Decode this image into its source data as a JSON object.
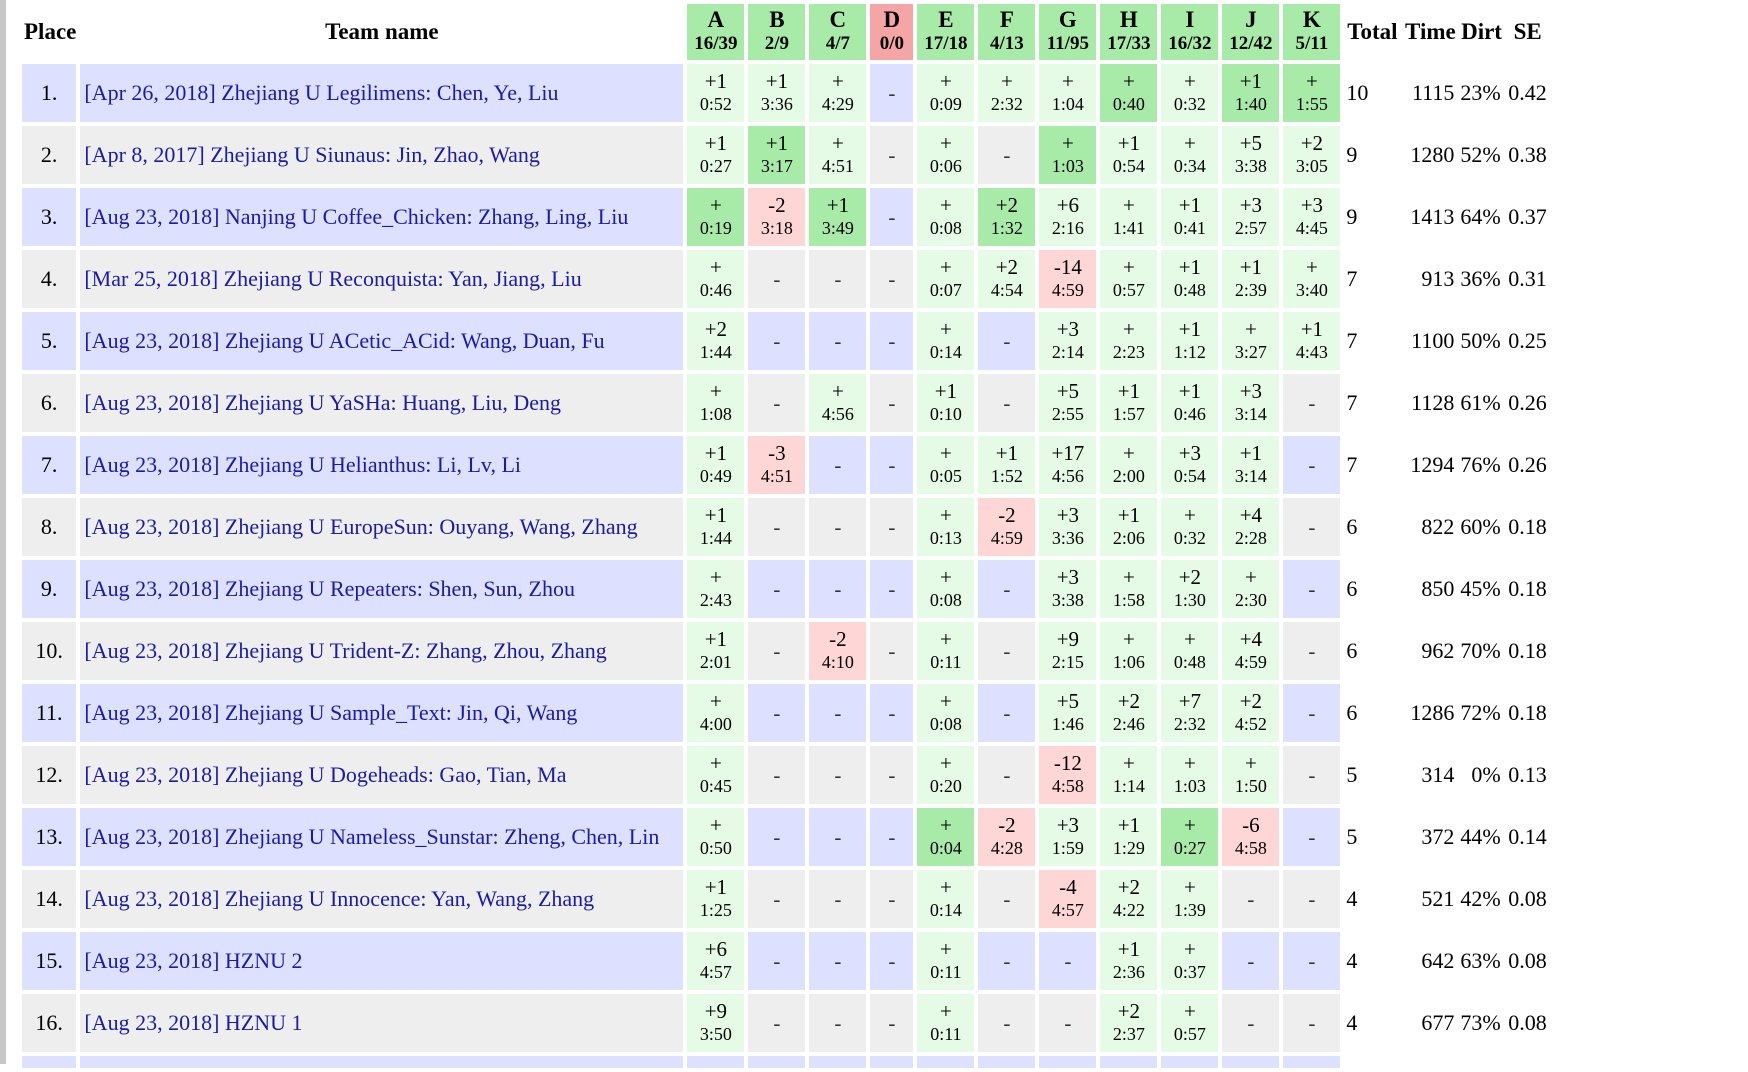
{
  "header": {
    "place": "Place",
    "team": "Team name",
    "total": "Total",
    "time": "Time",
    "dirt": "Dirt",
    "se": "SE"
  },
  "problems": [
    {
      "letter": "A",
      "ratio": "16/39",
      "color": "green"
    },
    {
      "letter": "B",
      "ratio": "2/9",
      "color": "green"
    },
    {
      "letter": "C",
      "ratio": "4/7",
      "color": "green"
    },
    {
      "letter": "D",
      "ratio": "0/0",
      "color": "red"
    },
    {
      "letter": "E",
      "ratio": "17/18",
      "color": "green"
    },
    {
      "letter": "F",
      "ratio": "4/13",
      "color": "green"
    },
    {
      "letter": "G",
      "ratio": "11/95",
      "color": "green"
    },
    {
      "letter": "H",
      "ratio": "17/33",
      "color": "green"
    },
    {
      "letter": "I",
      "ratio": "16/32",
      "color": "green"
    },
    {
      "letter": "J",
      "ratio": "12/42",
      "color": "green"
    },
    {
      "letter": "K",
      "ratio": "5/11",
      "color": "green"
    }
  ],
  "colors": {
    "first_solve": "#a8eba8",
    "solved": "#e5fbe5",
    "failed": "#ffd6d6",
    "row_odd": "#dde0ff",
    "row_even": "#eeeeee",
    "link": "#1a1ab0"
  },
  "rows": [
    {
      "place": "1.",
      "team": "[Apr 26, 2018] Zhejiang U Legilimens: Chen, Ye, Liu",
      "cells": [
        [
          "+1",
          "0:52",
          "s"
        ],
        [
          "+1",
          "3:36",
          "s"
        ],
        [
          "+",
          "4:29",
          "s"
        ],
        [
          "-",
          "",
          "n"
        ],
        [
          "+",
          "0:09",
          "s"
        ],
        [
          "+",
          "2:32",
          "s"
        ],
        [
          "+",
          "1:04",
          "s"
        ],
        [
          "+",
          "0:40",
          "f"
        ],
        [
          "+",
          "0:32",
          "s"
        ],
        [
          "+1",
          "1:40",
          "f"
        ],
        [
          "+",
          "1:55",
          "f"
        ]
      ],
      "total": "10",
      "time": "1115",
      "dirt": "23%",
      "se": "0.42"
    },
    {
      "place": "2.",
      "team": "[Apr 8, 2017] Zhejiang U Siunaus: Jin, Zhao, Wang",
      "cells": [
        [
          "+1",
          "0:27",
          "s"
        ],
        [
          "+1",
          "3:17",
          "f"
        ],
        [
          "+",
          "4:51",
          "s"
        ],
        [
          "-",
          "",
          "n"
        ],
        [
          "+",
          "0:06",
          "s"
        ],
        [
          "-",
          "",
          "n"
        ],
        [
          "+",
          "1:03",
          "f"
        ],
        [
          "+1",
          "0:54",
          "s"
        ],
        [
          "+",
          "0:34",
          "s"
        ],
        [
          "+5",
          "3:38",
          "s"
        ],
        [
          "+2",
          "3:05",
          "s"
        ]
      ],
      "total": "9",
      "time": "1280",
      "dirt": "52%",
      "se": "0.38"
    },
    {
      "place": "3.",
      "team": "[Aug 23, 2018] Nanjing U Coffee_Chicken: Zhang, Ling, Liu",
      "cells": [
        [
          "+",
          "0:19",
          "f"
        ],
        [
          "-2",
          "3:18",
          "x"
        ],
        [
          "+1",
          "3:49",
          "f"
        ],
        [
          "-",
          "",
          "n"
        ],
        [
          "+",
          "0:08",
          "s"
        ],
        [
          "+2",
          "1:32",
          "f"
        ],
        [
          "+6",
          "2:16",
          "s"
        ],
        [
          "+",
          "1:41",
          "s"
        ],
        [
          "+1",
          "0:41",
          "s"
        ],
        [
          "+3",
          "2:57",
          "s"
        ],
        [
          "+3",
          "4:45",
          "s"
        ]
      ],
      "total": "9",
      "time": "1413",
      "dirt": "64%",
      "se": "0.37"
    },
    {
      "place": "4.",
      "team": "[Mar 25, 2018] Zhejiang U Reconquista: Yan, Jiang, Liu",
      "cells": [
        [
          "+",
          "0:46",
          "s"
        ],
        [
          "-",
          "",
          "n"
        ],
        [
          "-",
          "",
          "n"
        ],
        [
          "-",
          "",
          "n"
        ],
        [
          "+",
          "0:07",
          "s"
        ],
        [
          "+2",
          "4:54",
          "s"
        ],
        [
          "-14",
          "4:59",
          "x"
        ],
        [
          "+",
          "0:57",
          "s"
        ],
        [
          "+1",
          "0:48",
          "s"
        ],
        [
          "+1",
          "2:39",
          "s"
        ],
        [
          "+",
          "3:40",
          "s"
        ]
      ],
      "total": "7",
      "time": "913",
      "dirt": "36%",
      "se": "0.31"
    },
    {
      "place": "5.",
      "team": "[Aug 23, 2018] Zhejiang U ACetic_ACid: Wang, Duan, Fu",
      "cells": [
        [
          "+2",
          "1:44",
          "s"
        ],
        [
          "-",
          "",
          "n"
        ],
        [
          "-",
          "",
          "n"
        ],
        [
          "-",
          "",
          "n"
        ],
        [
          "+",
          "0:14",
          "s"
        ],
        [
          "-",
          "",
          "n"
        ],
        [
          "+3",
          "2:14",
          "s"
        ],
        [
          "+",
          "2:23",
          "s"
        ],
        [
          "+1",
          "1:12",
          "s"
        ],
        [
          "+",
          "3:27",
          "s"
        ],
        [
          "+1",
          "4:43",
          "s"
        ]
      ],
      "total": "7",
      "time": "1100",
      "dirt": "50%",
      "se": "0.25"
    },
    {
      "place": "6.",
      "team": "[Aug 23, 2018] Zhejiang U YaSHa: Huang, Liu, Deng",
      "cells": [
        [
          "+",
          "1:08",
          "s"
        ],
        [
          "-",
          "",
          "n"
        ],
        [
          "+",
          "4:56",
          "s"
        ],
        [
          "-",
          "",
          "n"
        ],
        [
          "+1",
          "0:10",
          "s"
        ],
        [
          "-",
          "",
          "n"
        ],
        [
          "+5",
          "2:55",
          "s"
        ],
        [
          "+1",
          "1:57",
          "s"
        ],
        [
          "+1",
          "0:46",
          "s"
        ],
        [
          "+3",
          "3:14",
          "s"
        ],
        [
          "-",
          "",
          "n"
        ]
      ],
      "total": "7",
      "time": "1128",
      "dirt": "61%",
      "se": "0.26"
    },
    {
      "place": "7.",
      "team": "[Aug 23, 2018] Zhejiang U Helianthus: Li, Lv, Li",
      "cells": [
        [
          "+1",
          "0:49",
          "s"
        ],
        [
          "-3",
          "4:51",
          "x"
        ],
        [
          "-",
          "",
          "n"
        ],
        [
          "-",
          "",
          "n"
        ],
        [
          "+",
          "0:05",
          "s"
        ],
        [
          "+1",
          "1:52",
          "s"
        ],
        [
          "+17",
          "4:56",
          "s"
        ],
        [
          "+",
          "2:00",
          "s"
        ],
        [
          "+3",
          "0:54",
          "s"
        ],
        [
          "+1",
          "3:14",
          "s"
        ],
        [
          "-",
          "",
          "n"
        ]
      ],
      "total": "7",
      "time": "1294",
      "dirt": "76%",
      "se": "0.26"
    },
    {
      "place": "8.",
      "team": "[Aug 23, 2018] Zhejiang U EuropeSun: Ouyang, Wang, Zhang",
      "cells": [
        [
          "+1",
          "1:44",
          "s"
        ],
        [
          "-",
          "",
          "n"
        ],
        [
          "-",
          "",
          "n"
        ],
        [
          "-",
          "",
          "n"
        ],
        [
          "+",
          "0:13",
          "s"
        ],
        [
          "-2",
          "4:59",
          "x"
        ],
        [
          "+3",
          "3:36",
          "s"
        ],
        [
          "+1",
          "2:06",
          "s"
        ],
        [
          "+",
          "0:32",
          "s"
        ],
        [
          "+4",
          "2:28",
          "s"
        ],
        [
          "-",
          "",
          "n"
        ]
      ],
      "total": "6",
      "time": "822",
      "dirt": "60%",
      "se": "0.18"
    },
    {
      "place": "9.",
      "team": "[Aug 23, 2018] Zhejiang U Repeaters: Shen, Sun, Zhou",
      "cells": [
        [
          "+",
          "2:43",
          "s"
        ],
        [
          "-",
          "",
          "n"
        ],
        [
          "-",
          "",
          "n"
        ],
        [
          "-",
          "",
          "n"
        ],
        [
          "+",
          "0:08",
          "s"
        ],
        [
          "-",
          "",
          "n"
        ],
        [
          "+3",
          "3:38",
          "s"
        ],
        [
          "+",
          "1:58",
          "s"
        ],
        [
          "+2",
          "1:30",
          "s"
        ],
        [
          "+",
          "2:30",
          "s"
        ],
        [
          "-",
          "",
          "n"
        ]
      ],
      "total": "6",
      "time": "850",
      "dirt": "45%",
      "se": "0.18"
    },
    {
      "place": "10.",
      "team": "[Aug 23, 2018] Zhejiang U Trident-Z: Zhang, Zhou, Zhang",
      "cells": [
        [
          "+1",
          "2:01",
          "s"
        ],
        [
          "-",
          "",
          "n"
        ],
        [
          "-2",
          "4:10",
          "x"
        ],
        [
          "-",
          "",
          "n"
        ],
        [
          "+",
          "0:11",
          "s"
        ],
        [
          "-",
          "",
          "n"
        ],
        [
          "+9",
          "2:15",
          "s"
        ],
        [
          "+",
          "1:06",
          "s"
        ],
        [
          "+",
          "0:48",
          "s"
        ],
        [
          "+4",
          "4:59",
          "s"
        ],
        [
          "-",
          "",
          "n"
        ]
      ],
      "total": "6",
      "time": "962",
      "dirt": "70%",
      "se": "0.18"
    },
    {
      "place": "11.",
      "team": "[Aug 23, 2018] Zhejiang U Sample_Text: Jin, Qi, Wang",
      "cells": [
        [
          "+",
          "4:00",
          "s"
        ],
        [
          "-",
          "",
          "n"
        ],
        [
          "-",
          "",
          "n"
        ],
        [
          "-",
          "",
          "n"
        ],
        [
          "+",
          "0:08",
          "s"
        ],
        [
          "-",
          "",
          "n"
        ],
        [
          "+5",
          "1:46",
          "s"
        ],
        [
          "+2",
          "2:46",
          "s"
        ],
        [
          "+7",
          "2:32",
          "s"
        ],
        [
          "+2",
          "4:52",
          "s"
        ],
        [
          "-",
          "",
          "n"
        ]
      ],
      "total": "6",
      "time": "1286",
      "dirt": "72%",
      "se": "0.18"
    },
    {
      "place": "12.",
      "team": "[Aug 23, 2018] Zhejiang U Dogeheads: Gao, Tian, Ma",
      "cells": [
        [
          "+",
          "0:45",
          "s"
        ],
        [
          "-",
          "",
          "n"
        ],
        [
          "-",
          "",
          "n"
        ],
        [
          "-",
          "",
          "n"
        ],
        [
          "+",
          "0:20",
          "s"
        ],
        [
          "-",
          "",
          "n"
        ],
        [
          "-12",
          "4:58",
          "x"
        ],
        [
          "+",
          "1:14",
          "s"
        ],
        [
          "+",
          "1:03",
          "s"
        ],
        [
          "+",
          "1:50",
          "s"
        ],
        [
          "-",
          "",
          "n"
        ]
      ],
      "total": "5",
      "time": "314",
      "dirt": "0%",
      "se": "0.13"
    },
    {
      "place": "13.",
      "team": "[Aug 23, 2018] Zhejiang U Nameless_Sunstar: Zheng, Chen, Lin",
      "cells": [
        [
          "+",
          "0:50",
          "s"
        ],
        [
          "-",
          "",
          "n"
        ],
        [
          "-",
          "",
          "n"
        ],
        [
          "-",
          "",
          "n"
        ],
        [
          "+",
          "0:04",
          "f"
        ],
        [
          "-2",
          "4:28",
          "x"
        ],
        [
          "+3",
          "1:59",
          "s"
        ],
        [
          "+1",
          "1:29",
          "s"
        ],
        [
          "+",
          "0:27",
          "f"
        ],
        [
          "-6",
          "4:58",
          "x"
        ],
        [
          "-",
          "",
          "n"
        ]
      ],
      "total": "5",
      "time": "372",
      "dirt": "44%",
      "se": "0.14"
    },
    {
      "place": "14.",
      "team": "[Aug 23, 2018] Zhejiang U Innocence: Yan, Wang, Zhang",
      "cells": [
        [
          "+1",
          "1:25",
          "s"
        ],
        [
          "-",
          "",
          "n"
        ],
        [
          "-",
          "",
          "n"
        ],
        [
          "-",
          "",
          "n"
        ],
        [
          "+",
          "0:14",
          "s"
        ],
        [
          "-",
          "",
          "n"
        ],
        [
          "-4",
          "4:57",
          "x"
        ],
        [
          "+2",
          "4:22",
          "s"
        ],
        [
          "+",
          "1:39",
          "s"
        ],
        [
          "-",
          "",
          "n"
        ],
        [
          "-",
          "",
          "n"
        ]
      ],
      "total": "4",
      "time": "521",
      "dirt": "42%",
      "se": "0.08"
    },
    {
      "place": "15.",
      "team": "[Aug 23, 2018] HZNU 2",
      "cells": [
        [
          "+6",
          "4:57",
          "s"
        ],
        [
          "-",
          "",
          "n"
        ],
        [
          "-",
          "",
          "n"
        ],
        [
          "-",
          "",
          "n"
        ],
        [
          "+",
          "0:11",
          "s"
        ],
        [
          "-",
          "",
          "n"
        ],
        [
          "-",
          "",
          "n"
        ],
        [
          "+1",
          "2:36",
          "s"
        ],
        [
          "+",
          "0:37",
          "s"
        ],
        [
          "-",
          "",
          "n"
        ],
        [
          "-",
          "",
          "n"
        ]
      ],
      "total": "4",
      "time": "642",
      "dirt": "63%",
      "se": "0.08"
    },
    {
      "place": "16.",
      "team": "[Aug 23, 2018] HZNU 1",
      "cells": [
        [
          "+9",
          "3:50",
          "s"
        ],
        [
          "-",
          "",
          "n"
        ],
        [
          "-",
          "",
          "n"
        ],
        [
          "-",
          "",
          "n"
        ],
        [
          "+",
          "0:11",
          "s"
        ],
        [
          "-",
          "",
          "n"
        ],
        [
          "-",
          "",
          "n"
        ],
        [
          "+2",
          "2:37",
          "s"
        ],
        [
          "+",
          "0:57",
          "s"
        ],
        [
          "-",
          "",
          "n"
        ],
        [
          "-",
          "",
          "n"
        ]
      ],
      "total": "4",
      "time": "677",
      "dirt": "73%",
      "se": "0.08"
    }
  ]
}
